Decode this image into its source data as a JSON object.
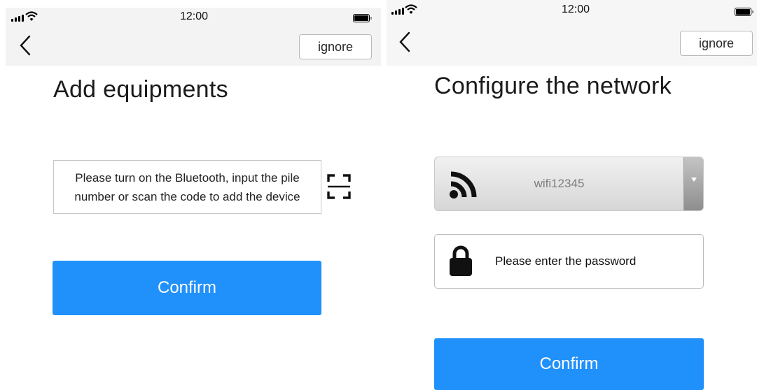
{
  "left_screen": {
    "status": {
      "time": "12:00"
    },
    "nav": {
      "back_icon": "chevron-left-icon",
      "ignore_label": "ignore"
    },
    "title": "Add equipments",
    "instruction": "Please turn on the Bluetooth, input the pile number or scan the code to add the device",
    "scan_icon": "scan-frame-icon",
    "confirm_label": "Confirm"
  },
  "right_screen": {
    "status": {
      "time": "12:00"
    },
    "nav": {
      "back_icon": "chevron-left-icon",
      "ignore_label": "ignore"
    },
    "title": "Configure the network",
    "wifi": {
      "icon": "wifi-icon",
      "selected": "wifi12345"
    },
    "password": {
      "icon": "lock-icon",
      "placeholder": "Please enter the password"
    },
    "confirm_label": "Confirm"
  },
  "colors": {
    "accent": "#2090fb",
    "header_bg": "#f3f3f3"
  }
}
